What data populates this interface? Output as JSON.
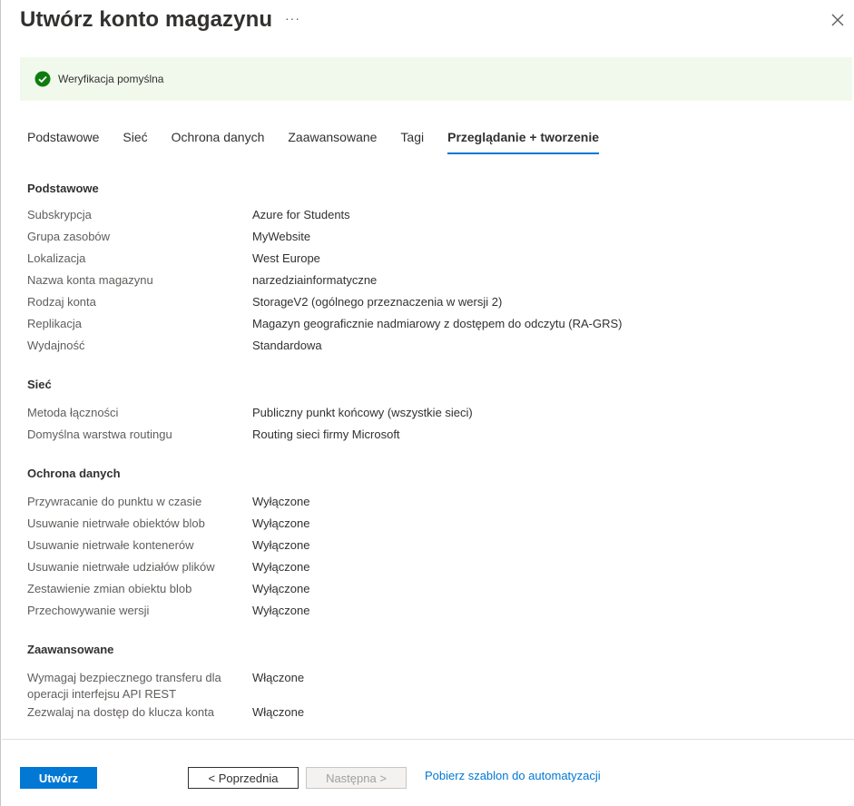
{
  "header": {
    "title": "Utwórz konto magazynu",
    "more_label": "···",
    "close_icon": "close-icon"
  },
  "banner": {
    "icon": "check-circle-icon",
    "text": "Weryfikacja pomyślna",
    "color": "#f1f9ec",
    "icon_color": "#107c10"
  },
  "tabs": [
    {
      "label": "Podstawowe"
    },
    {
      "label": "Sieć"
    },
    {
      "label": "Ochrona danych"
    },
    {
      "label": "Zaawansowane"
    },
    {
      "label": "Tagi"
    },
    {
      "label": "Przeglądanie + tworzenie",
      "active": true
    }
  ],
  "sections": {
    "basics": {
      "title": "Podstawowe",
      "rows": [
        {
          "k": "Subskrypcja",
          "v": "Azure for Students"
        },
        {
          "k": "Grupa zasobów",
          "v": "MyWebsite"
        },
        {
          "k": "Lokalizacja",
          "v": "West Europe"
        },
        {
          "k": "Nazwa konta magazynu",
          "v": "narzedziainformatyczne"
        },
        {
          "k": "Rodzaj konta",
          "v": "StorageV2 (ogólnego przeznaczenia w wersji 2)"
        },
        {
          "k": "Replikacja",
          "v": "Magazyn geograficznie nadmiarowy z dostępem do odczytu (RA-GRS)"
        },
        {
          "k": "Wydajność",
          "v": "Standardowa"
        }
      ]
    },
    "network": {
      "title": "Sieć",
      "rows": [
        {
          "k": "Metoda łączności",
          "v": "Publiczny punkt końcowy (wszystkie sieci)"
        },
        {
          "k": "Domyślna warstwa routingu",
          "v": "Routing sieci firmy Microsoft"
        }
      ]
    },
    "data_protection": {
      "title": "Ochrona danych",
      "rows": [
        {
          "k": "Przywracanie do punktu w czasie",
          "v": "Wyłączone"
        },
        {
          "k": "Usuwanie nietrwałe obiektów blob",
          "v": "Wyłączone"
        },
        {
          "k": "Usuwanie nietrwałe kontenerów",
          "v": "Wyłączone"
        },
        {
          "k": "Usuwanie nietrwałe udziałów plików",
          "v": "Wyłączone"
        },
        {
          "k": "Zestawienie zmian obiektu blob",
          "v": "Wyłączone"
        },
        {
          "k": "Przechowywanie wersji",
          "v": "Wyłączone"
        }
      ]
    },
    "advanced": {
      "title": "Zaawansowane",
      "rows": [
        {
          "k": "Wymagaj bezpiecznego transferu dla operacji interfejsu API REST",
          "v": "Włączone"
        },
        {
          "k": "Zezwalaj na dostęp do klucza konta",
          "v": "Włączone"
        }
      ]
    }
  },
  "footer": {
    "create_label": "Utwórz",
    "prev_label": "< Poprzednia",
    "next_label": "Następna >",
    "automation_link": "Pobierz szablon do automatyzacji",
    "accent": "#0078d4"
  }
}
